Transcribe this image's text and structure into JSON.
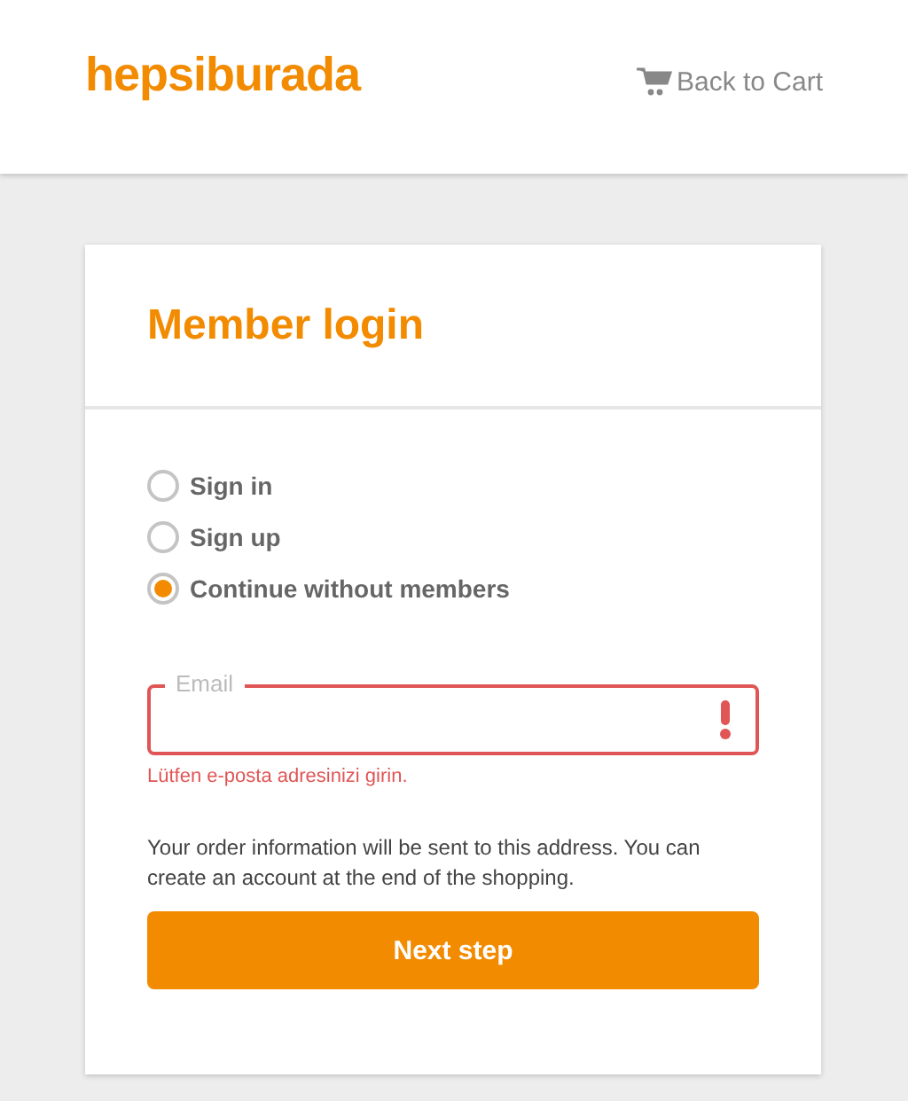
{
  "header": {
    "logo": "hepsiburada",
    "back_link": "Back to Cart"
  },
  "card": {
    "title": "Member login",
    "options": [
      {
        "label": "Sign in",
        "selected": false
      },
      {
        "label": "Sign up",
        "selected": false
      },
      {
        "label": "Continue without members",
        "selected": true
      }
    ],
    "email": {
      "label": "Email",
      "invalid": true,
      "error": "Lütfen e-posta adresinizi girin."
    },
    "note": "Your order information will be sent to this address. You can create an account at the end of the shopping.",
    "button": "Next step"
  }
}
